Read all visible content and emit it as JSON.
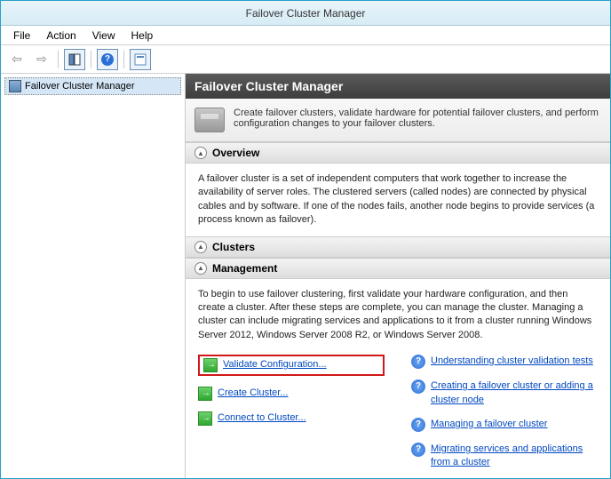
{
  "window": {
    "title": "Failover Cluster Manager"
  },
  "menu": {
    "file": "File",
    "action": "Action",
    "view": "View",
    "help": "Help"
  },
  "tree": {
    "root": "Failover Cluster Manager"
  },
  "content": {
    "header": "Failover Cluster Manager",
    "intro": "Create failover clusters, validate hardware for potential failover clusters, and perform configuration changes to your failover clusters.",
    "sections": {
      "overview": {
        "title": "Overview",
        "body": "A failover cluster is a set of independent computers that work together to increase the availability of server roles. The clustered servers (called nodes) are connected by physical cables and by software. If one of the nodes fails, another node begins to provide services (a process known as failover)."
      },
      "clusters": {
        "title": "Clusters"
      },
      "management": {
        "title": "Management",
        "body": "To begin to use failover clustering, first validate your hardware configuration, and then create a cluster.  After these steps are complete, you can manage the cluster. Managing a cluster can include migrating services and applications to it from a cluster running Windows Server 2012, Windows Server 2008 R2, or Windows Server 2008.",
        "actions": {
          "validate": "Validate Configuration...",
          "create": "Create Cluster...",
          "connect": "Connect to Cluster..."
        },
        "help": {
          "validation_tests": "Understanding cluster validation tests",
          "create_add": "Creating a failover cluster or adding a cluster node",
          "managing": "Managing a failover cluster",
          "migrating": "Migrating services and applications from a cluster"
        }
      }
    }
  }
}
